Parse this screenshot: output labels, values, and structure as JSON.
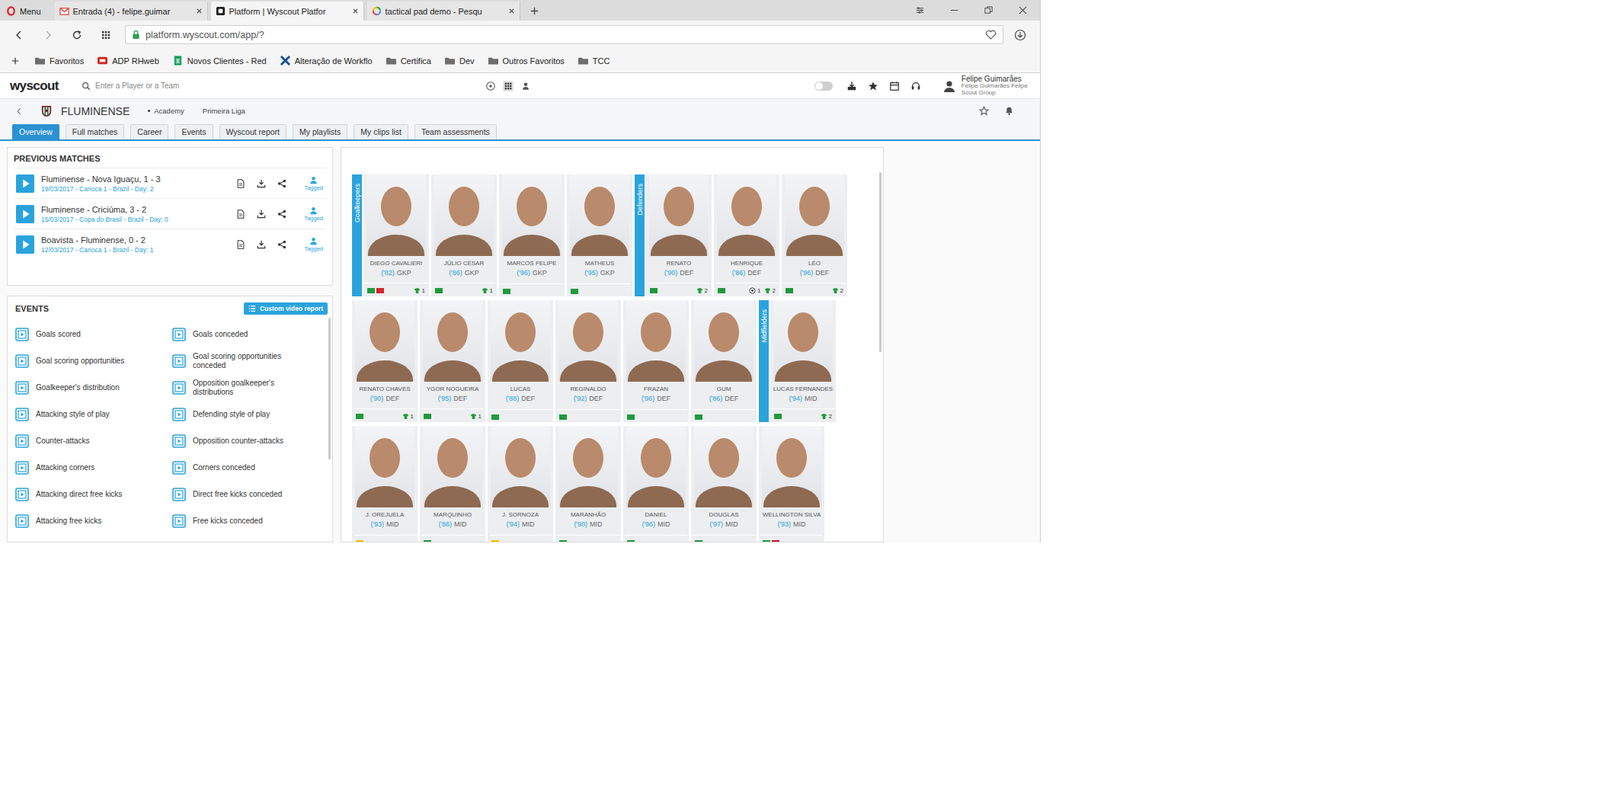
{
  "browser": {
    "tabs": [
      {
        "label": "Menu",
        "kind": "menu",
        "selected": false
      },
      {
        "label": "Entrada (4) - felipe.guimar",
        "kind": "gmail",
        "selected": false
      },
      {
        "label": "Platform | Wyscout Platfor",
        "kind": "wyscout",
        "selected": true
      },
      {
        "label": "tactical pad demo - Pesqu",
        "kind": "google",
        "selected": false
      }
    ],
    "url": "platform.wyscout.com/app/?",
    "bookmarks": [
      {
        "label": "Favoritos",
        "kind": "folder"
      },
      {
        "label": "ADP RHweb",
        "kind": "adp"
      },
      {
        "label": "Novos Clientes - Red",
        "kind": "sheets"
      },
      {
        "label": "Alteração de Workflo",
        "kind": "tool"
      },
      {
        "label": "Certifica",
        "kind": "folder"
      },
      {
        "label": "Dev",
        "kind": "folder"
      },
      {
        "label": "Outros Favoritos",
        "kind": "folder"
      },
      {
        "label": "TCC",
        "kind": "folder"
      }
    ]
  },
  "app": {
    "logo": "wyscout",
    "search_placeholder": "Enter a Player or a Team",
    "dark_mode_on": false,
    "user": {
      "name": "Felipe Guimarães",
      "org_lines": [
        "Felipe Guimarães Felipe",
        "Scout Group"
      ]
    }
  },
  "team": {
    "name": "FLUMINENSE",
    "category": "Academy",
    "league": "Primeira Liga"
  },
  "nav_tabs": [
    {
      "label": "Overview",
      "selected": true
    },
    {
      "label": "Full matches",
      "selected": false
    },
    {
      "label": "Career",
      "selected": false
    },
    {
      "label": "Events",
      "selected": false
    },
    {
      "label": "Wyscout report",
      "selected": false
    },
    {
      "label": "My playlists",
      "selected": false
    },
    {
      "label": "My clips list",
      "selected": false
    },
    {
      "label": "Team assessments",
      "selected": false
    }
  ],
  "previous_matches": {
    "title": "PREVIOUS MATCHES",
    "matches": [
      {
        "title": "Fluminense - Nova Iguaçu, 1 - 3",
        "details": "19/03/2017 - Carioca 1 - Brazil - Day: 2",
        "tag": "Tagged"
      },
      {
        "title": "Fluminense - Criciúma, 3 - 2",
        "details": "15/03/2017 - Copa do Brasil - Brazil - Day: 0",
        "tag": "Tagged"
      },
      {
        "title": "Boavista - Fluminense, 0 - 2",
        "details": "12/03/2017 - Carioca 1 - Brazil - Day: 1",
        "tag": "Tagged"
      }
    ]
  },
  "events": {
    "title": "EVENTS",
    "button": "Custom video report",
    "items": [
      "Goals scored",
      "Goals conceded",
      "Goal scoring opportunities",
      "Goal scoring opportunities conceded",
      "Goalkeeper's distribution",
      "Opposition goalkeeper's distributions",
      "Attacking style of play",
      "Defending style of play",
      "Counter-attacks",
      "Opposition counter-attacks",
      "Attacking corners",
      "Corners conceded",
      "Attacking direct free kicks",
      "Direct free kicks conceded",
      "Attacking free kicks",
      "Free kicks conceded"
    ]
  },
  "squad": {
    "groups": [
      {
        "label": "Goalkeepers",
        "players": [
          {
            "name": "DIEGO CAVALIERI",
            "year": "('82)",
            "position": "GKP",
            "flags": [
              "#1f9a3d",
              "#d22630"
            ],
            "stats": [
              {
                "kind": "match",
                "value": "1"
              }
            ]
          },
          {
            "name": "JÚLIO CÉSAR",
            "year": "('86)",
            "position": "GKP",
            "flags": [
              "#1f9a3d"
            ],
            "stats": [
              {
                "kind": "match",
                "value": "1"
              }
            ]
          },
          {
            "name": "MARCOS FELIPE",
            "year": "('96)",
            "position": "GKP",
            "flags": [
              "#1f9a3d"
            ],
            "stats": []
          },
          {
            "name": "MATHEUS",
            "year": "('95)",
            "position": "GKP",
            "flags": [
              "#1f9a3d"
            ],
            "stats": []
          }
        ]
      },
      {
        "label": "Defenders",
        "players": [
          {
            "name": "RENATO",
            "year": "('90)",
            "position": "DEF",
            "flags": [
              "#1f9a3d"
            ],
            "stats": [
              {
                "kind": "match",
                "value": "2"
              }
            ]
          },
          {
            "name": "HENRIQUE",
            "year": "('86)",
            "position": "DEF",
            "flags": [
              "#1f9a3d"
            ],
            "stats": [
              {
                "kind": "goal",
                "value": "1"
              },
              {
                "kind": "match",
                "value": "2"
              }
            ]
          },
          {
            "name": "LÉO",
            "year": "('96)",
            "position": "DEF",
            "flags": [
              "#1f9a3d"
            ],
            "stats": [
              {
                "kind": "match",
                "value": "2"
              }
            ]
          },
          {
            "name": "RENATO CHAVES",
            "year": "('90)",
            "position": "DEF",
            "flags": [
              "#1f9a3d"
            ],
            "stats": [
              {
                "kind": "match",
                "value": "1"
              }
            ]
          },
          {
            "name": "YGOR NOGUEIRA",
            "year": "('95)",
            "position": "DEF",
            "flags": [
              "#1f9a3d"
            ],
            "stats": [
              {
                "kind": "match",
                "value": "1"
              }
            ]
          },
          {
            "name": "LUCAS",
            "year": "('88)",
            "position": "DEF",
            "flags": [
              "#1f9a3d"
            ],
            "stats": []
          },
          {
            "name": "REGINALDO",
            "year": "('92)",
            "position": "DEF",
            "flags": [
              "#1f9a3d"
            ],
            "stats": []
          },
          {
            "name": "FRAZAN",
            "year": "('96)",
            "position": "DEF",
            "flags": [
              "#1f9a3d"
            ],
            "stats": []
          },
          {
            "name": "GUM",
            "year": "('86)",
            "position": "DEF",
            "flags": [
              "#1f9a3d"
            ],
            "stats": []
          }
        ]
      },
      {
        "label": "Midfielders",
        "players": [
          {
            "name": "LUCAS FERNANDES",
            "year": "('94)",
            "position": "MID",
            "flags": [
              "#1f9a3d"
            ],
            "stats": [
              {
                "kind": "match",
                "value": "2"
              }
            ]
          },
          {
            "name": "J. OREJUELA",
            "year": "('93)",
            "position": "MID",
            "flags": [
              "#f2c400"
            ],
            "stats": []
          },
          {
            "name": "MARQUINHO",
            "year": "('86)",
            "position": "MID",
            "flags": [
              "#1f9a3d"
            ],
            "stats": []
          },
          {
            "name": "J. SORNOZA",
            "year": "('94)",
            "position": "MID",
            "flags": [
              "#f2c400"
            ],
            "stats": []
          },
          {
            "name": "MARANHÃO",
            "year": "('90)",
            "position": "MID",
            "flags": [
              "#1f9a3d"
            ],
            "stats": []
          },
          {
            "name": "DANIEL",
            "year": "('96)",
            "position": "MID",
            "flags": [
              "#1f9a3d"
            ],
            "stats": []
          },
          {
            "name": "DOUGLAS",
            "year": "('97)",
            "position": "MID",
            "flags": [
              "#1f9a3d"
            ],
            "stats": []
          },
          {
            "name": "WELLINGTON SILVA",
            "year": "('93)",
            "position": "MID",
            "flags": [
              "#1f9a3d",
              "#c8102e"
            ],
            "stats": []
          }
        ]
      }
    ]
  }
}
